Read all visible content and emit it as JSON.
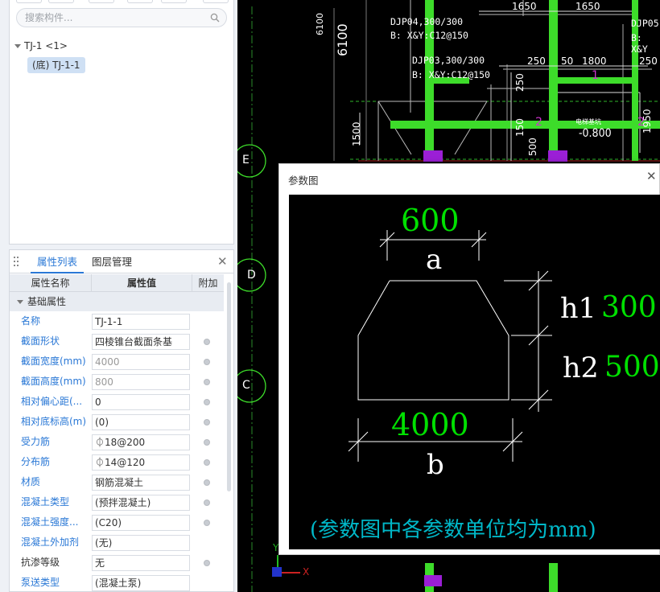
{
  "tree": {
    "search_placeholder": "搜索构件...",
    "root_label": "TJ-1 <1>",
    "child_label": "(底) TJ-1-1"
  },
  "properties": {
    "tabs": [
      "属性列表",
      "图层管理"
    ],
    "close_icon": "close-icon",
    "columns": {
      "name": "属性名称",
      "value": "属性值",
      "add": "附加"
    },
    "group_label": "基础属性",
    "rows": [
      {
        "name": "名称",
        "value": "TJ-1-1",
        "dot": false,
        "muted": false,
        "plain": false
      },
      {
        "name": "截面形状",
        "value": "四棱锥台截面条基",
        "dot": true,
        "muted": false,
        "plain": false
      },
      {
        "name": "截面宽度(mm)",
        "value": "4000",
        "dot": true,
        "muted": true,
        "plain": false
      },
      {
        "name": "截面高度(mm)",
        "value": "800",
        "dot": true,
        "muted": true,
        "plain": false
      },
      {
        "name": "相对偏心距(...",
        "value": "0",
        "dot": true,
        "muted": false,
        "plain": false
      },
      {
        "name": "相对底标高(m)",
        "value": "(0)",
        "dot": true,
        "muted": false,
        "plain": false
      },
      {
        "name": "受力筋",
        "value": "⏀18@200",
        "dot": true,
        "muted": false,
        "plain": false
      },
      {
        "name": "分布筋",
        "value": "⏀14@120",
        "dot": true,
        "muted": false,
        "plain": false
      },
      {
        "name": "材质",
        "value": "钢筋混凝土",
        "dot": true,
        "muted": false,
        "plain": false
      },
      {
        "name": "混凝土类型",
        "value": "(预拌混凝土)",
        "dot": true,
        "muted": false,
        "plain": false
      },
      {
        "name": "混凝土强度...",
        "value": "(C20)",
        "dot": true,
        "muted": false,
        "plain": false
      },
      {
        "name": "混凝土外加剂",
        "value": "(无)",
        "dot": false,
        "muted": false,
        "plain": false
      },
      {
        "name": "抗渗等级",
        "value": "无",
        "dot": true,
        "muted": false,
        "plain": true
      },
      {
        "name": "泵送类型",
        "value": "(混凝土泵)",
        "dot": false,
        "muted": false,
        "plain": false
      }
    ]
  },
  "cad": {
    "labels": {
      "djp04": "DJP04,300/300",
      "djp04_rebar": "B: X&Y:C12@150",
      "djp03": "DJP03,300/300",
      "djp03_rebar": "B: X&Y:C12@150",
      "djp05": "DJP05,",
      "djp05_rebar": "B: X&Y",
      "dim_1650_a": "1650",
      "dim_1650_b": "1650",
      "dim_250_a": "250",
      "dim_50": "50",
      "dim_1800": "1800",
      "dim_250_b": "250",
      "dim_6100_small": "6100",
      "dim_6100_large": "6100",
      "dim_1500": "1500",
      "dim_250_v": "250",
      "dim_150": "150",
      "dim_500": "500",
      "dim_1950": "1950",
      "magenta_1": "1",
      "magenta_2a": "2",
      "magenta_2b": "2",
      "elev_label": "-0.800",
      "note_small": "电梯基坑",
      "axis_e": "E",
      "axis_d": "D",
      "axis_c": "C",
      "ucs_x": "X",
      "ucs_y": "Y"
    },
    "colors": {
      "green": "#3ddc2a",
      "magenta": "#cc33cc",
      "purple": "#9b1fd6",
      "axis_circle": "#3ddc2a"
    }
  },
  "dialog": {
    "title": "参数图",
    "close_icon": "close-icon",
    "dim_a_value": "600",
    "dim_a_label": "a",
    "h1_label": "h1",
    "h1_value": "300",
    "h2_label": "h2",
    "h2_value": "500",
    "dim_b_value": "4000",
    "dim_b_label": "b",
    "note": "(参数图中各参数单位均为mm)",
    "colors": {
      "value_green": "#00e000",
      "note_cyan": "#00b8c8",
      "line_white": "#ffffff"
    }
  }
}
